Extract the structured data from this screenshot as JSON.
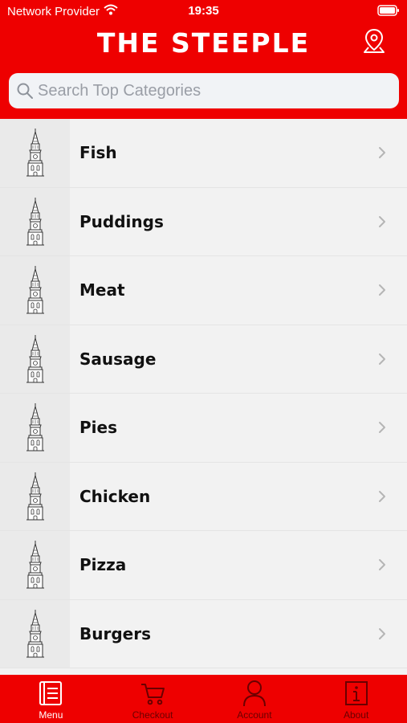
{
  "status_bar": {
    "carrier": "Network Provider",
    "time": "19:35"
  },
  "header": {
    "title": "THE STEEPLE"
  },
  "search": {
    "placeholder": "Search Top Categories",
    "value": ""
  },
  "categories": [
    {
      "label": "Fish"
    },
    {
      "label": "Puddings"
    },
    {
      "label": "Meat"
    },
    {
      "label": "Sausage"
    },
    {
      "label": "Pies"
    },
    {
      "label": "Chicken"
    },
    {
      "label": "Pizza"
    },
    {
      "label": "Burgers"
    }
  ],
  "tabs": [
    {
      "label": "Menu",
      "icon": "menu-book-icon",
      "active": true
    },
    {
      "label": "Checkout",
      "icon": "cart-icon",
      "active": false
    },
    {
      "label": "Account",
      "icon": "person-icon",
      "active": false
    },
    {
      "label": "About",
      "icon": "info-icon",
      "active": false
    }
  ],
  "colors": {
    "brand_red": "#ee0000",
    "inactive_tab": "#6a0000",
    "list_background": "#f2f2f2"
  }
}
